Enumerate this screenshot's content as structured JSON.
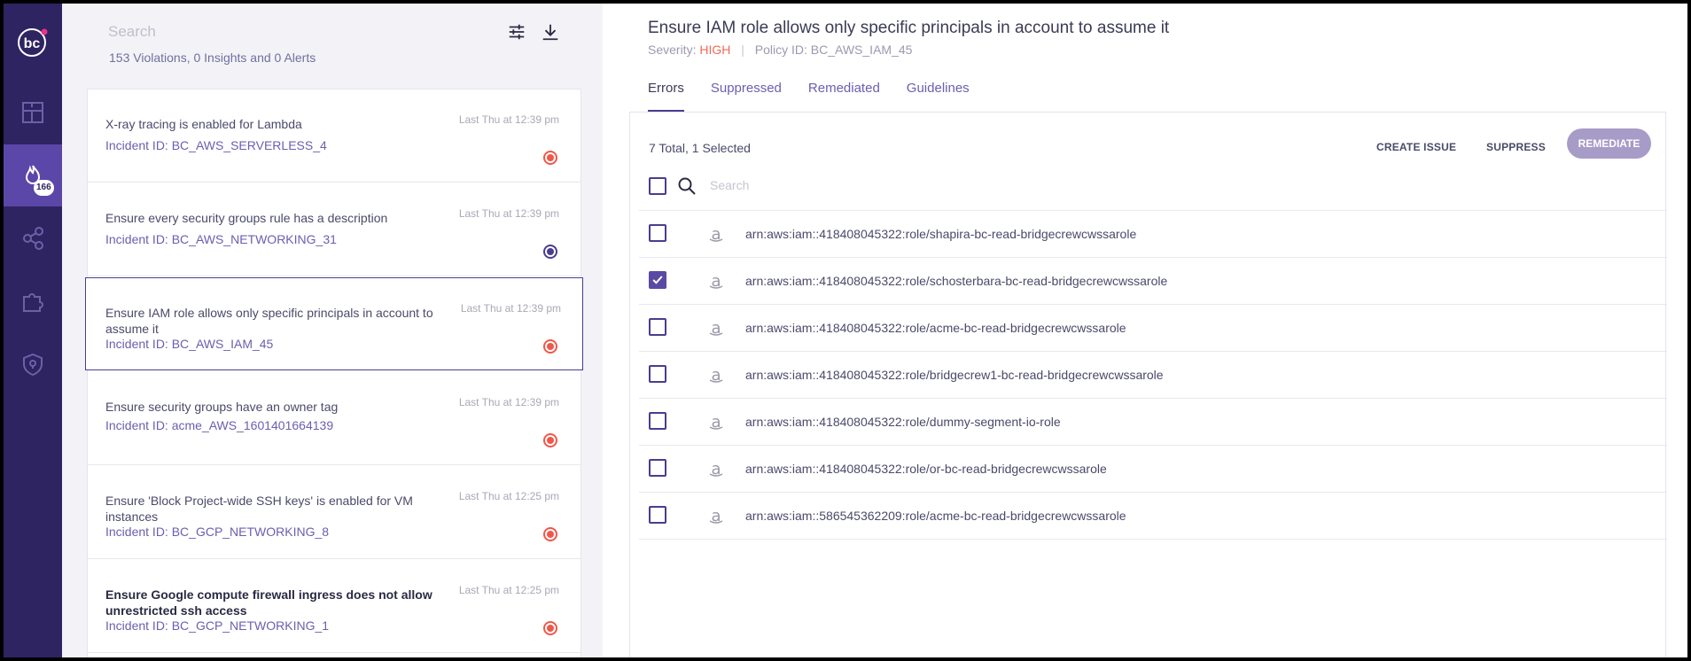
{
  "nav": {
    "logo_text": "bc",
    "badge_count": "166",
    "items": [
      {
        "icon": "dashboard-icon"
      },
      {
        "icon": "incidents-icon",
        "active": true
      },
      {
        "icon": "graph-icon"
      },
      {
        "icon": "integrations-icon"
      },
      {
        "icon": "shield-icon"
      }
    ]
  },
  "list": {
    "search_placeholder": "Search",
    "summary": "153 Violations, 0 Insights and 0 Alerts",
    "cards": [
      {
        "title": "X-ray tracing is enabled for Lambda",
        "incident_id": "Incident ID: BC_AWS_SERVERLESS_4",
        "time": "Last Thu at 12:39 pm",
        "severity_color": "#f0574a"
      },
      {
        "title": "Ensure every security groups rule has a description",
        "incident_id": "Incident ID: BC_AWS_NETWORKING_31",
        "time": "Last Thu at 12:39 pm",
        "severity_color": "#4a3d8f"
      },
      {
        "title": "Ensure IAM role allows only specific principals in account to assume it",
        "incident_id": "Incident ID: BC_AWS_IAM_45",
        "time": "Last Thu at 12:39 pm",
        "severity_color": "#f0574a",
        "selected": true
      },
      {
        "title": "Ensure security groups have an owner tag",
        "incident_id": "Incident ID: acme_AWS_1601401664139",
        "time": "Last Thu at 12:39 pm",
        "severity_color": "#f0574a"
      },
      {
        "title": "Ensure 'Block Project-wide SSH keys' is enabled for VM instances",
        "incident_id": "Incident ID: BC_GCP_NETWORKING_8",
        "time": "Last Thu at 12:25 pm",
        "severity_color": "#f0574a"
      },
      {
        "title": "Ensure Google compute firewall ingress does not allow unrestricted ssh access",
        "incident_id": "Incident ID: BC_GCP_NETWORKING_1",
        "time": "Last Thu at 12:25 pm",
        "severity_color": "#f0574a",
        "bold": true
      }
    ]
  },
  "detail": {
    "title": "Ensure IAM role allows only specific principals in account to assume it",
    "severity_label": "Severity:",
    "severity_value": "HIGH",
    "separator": "|",
    "policy_id": "Policy ID: BC_AWS_IAM_45",
    "tabs": [
      "Errors",
      "Suppressed",
      "Remediated",
      "Guidelines"
    ],
    "active_tab": "Errors",
    "total": "7 Total, 1 Selected",
    "actions": {
      "create_issue": "CREATE ISSUE",
      "suppress": "SUPPRESS",
      "remediate": "REMEDIATE"
    },
    "search_placeholder": "Search",
    "resources": [
      {
        "arn": "arn:aws:iam::418408045322:role/shapira-bc-read-bridgecrewcwssarole",
        "checked": false
      },
      {
        "arn": "arn:aws:iam::418408045322:role/schosterbara-bc-read-bridgecrewcwssarole",
        "checked": true
      },
      {
        "arn": "arn:aws:iam::418408045322:role/acme-bc-read-bridgecrewcwssarole",
        "checked": false
      },
      {
        "arn": "arn:aws:iam::418408045322:role/bridgecrew1-bc-read-bridgecrewcwssarole",
        "checked": false
      },
      {
        "arn": "arn:aws:iam::418408045322:role/dummy-segment-io-role",
        "checked": false
      },
      {
        "arn": "arn:aws:iam::418408045322:role/or-bc-read-bridgecrewcwssarole",
        "checked": false
      },
      {
        "arn": "arn:aws:iam::586545362209:role/acme-bc-read-bridgecrewcwssarole",
        "checked": false
      }
    ]
  }
}
